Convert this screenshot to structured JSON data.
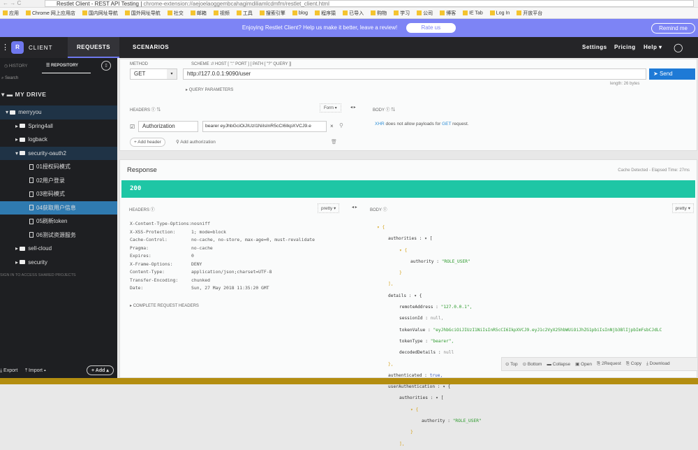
{
  "browser": {
    "tab_title": "Restlet Client - REST API Testing",
    "url": "chrome-extension://aejoelaoggembcahagimdiliamlcdmfm/restlet_client.html",
    "bookmarks": [
      "应用",
      "Chrome 网上应用店",
      "国内网址导航",
      "国外网址导航",
      "社交",
      "邮箱",
      "视频",
      "工具",
      "搜索引擎",
      "blog",
      "程序猿",
      "已导入",
      "购物",
      "学习",
      "公司",
      "博客",
      "IE Tab",
      "Log In",
      "开放平台"
    ]
  },
  "banner": {
    "text": "Enjoying Restlet Client? Help us make it better, leave a review!",
    "rate": "Rate us",
    "remind": "Remind me"
  },
  "nav": {
    "logo": "R",
    "client": "CLIENT",
    "tabs": [
      "REQUESTS",
      "SCENARIOS"
    ],
    "settings": "Settings",
    "pricing": "Pricing",
    "help": "Help ▾"
  },
  "sidebar": {
    "history": "HISTORY",
    "repository": "REPOSITORY",
    "search": "Search",
    "drive": "MY DRIVE",
    "project": "merryyou",
    "folders_top": [
      "Spring4all",
      "logback",
      "security-oauth2"
    ],
    "requests": [
      "01授权码模式",
      "02用户登录",
      "03密码模式",
      "04获取用户信息",
      "05刷新token",
      "06测试资源服务"
    ],
    "folders_bottom": [
      "sell-cloud",
      "security"
    ],
    "signin": "SIGN IN TO ACCESS SHARED PROJECTS",
    "export": "Export",
    "import": "Import ▴",
    "add": "Add ▴"
  },
  "request": {
    "method_label": "METHOD",
    "method": "GET",
    "scheme_label": "SCHEME :// HOST [ \":\" PORT ] [ PATH [ \"?\" QUERY ]]",
    "url": "http://127.0.0.1:9090/user",
    "send": "Send",
    "length": "length: 26 bytes",
    "query_params": "QUERY PARAMETERS",
    "headers_label": "HEADERS",
    "form": "Form ▾",
    "header_name": "Authorization",
    "header_value": "bearer eyJhbGciOiJIUzI1NiIsInR5cCI6IkpXVCJ9.e",
    "add_header": "+ Add header",
    "add_auth": "Add authorization",
    "body_label": "BODY",
    "body_xhr": "XHR",
    "body_msg": " does not allow payloads for ",
    "body_get": "GET",
    "body_end": " request."
  },
  "response": {
    "title": "Response",
    "cache": "Cache Detected - Elapsed Time: 27ms",
    "status": "200",
    "headers_label": "HEADERS",
    "pretty": "pretty ▾",
    "body_label": "BODY",
    "complete": "COMPLETE REQUEST HEADERS",
    "headers": [
      [
        "X-Content-Type-Options:",
        "nosniff"
      ],
      [
        "X-XSS-Protection:",
        "1; mode=block"
      ],
      [
        "Cache-Control:",
        "no-cache, no-store, max-age=0, must-revalidate"
      ],
      [
        "Pragma:",
        "no-cache"
      ],
      [
        "Expires:",
        "0"
      ],
      [
        "X-Frame-Options:",
        "DENY"
      ],
      [
        "Content-Type:",
        "application/json;charset=UTF-8"
      ],
      [
        "Transfer-Encoding:",
        "chunked"
      ],
      [
        "Date:",
        "Sun, 27 May 2018 11:35:20 GMT"
      ]
    ],
    "body_lines": [
      [
        "0",
        "▾ {",
        ""
      ],
      [
        "1",
        "authorities : ▾ [",
        ""
      ],
      [
        "2",
        "▾ {",
        ""
      ],
      [
        "3",
        "authority : ",
        "\"ROLE_USER\""
      ],
      [
        "2",
        "}",
        ""
      ],
      [
        "1",
        "],",
        ""
      ],
      [
        "1",
        "details : ▾ {",
        ""
      ],
      [
        "2",
        "remoteAddress : ",
        "\"127.0.0.1\","
      ],
      [
        "2",
        "sessionId : ",
        "null,"
      ],
      [
        "2",
        "tokenValue : ",
        "\"eyJhbGciOiJIUzI1NiIsInR5cCI6IkpXVCJ9.eyJ1c2VyX25hbWUiOiJhZG1pbiIsInNjb3BlIjpbImFsbCJdLC"
      ],
      [
        "2",
        "tokenType : ",
        "\"bearer\","
      ],
      [
        "2",
        "decodedDetails : ",
        "null"
      ],
      [
        "1",
        "},",
        ""
      ],
      [
        "1",
        "authenticated : ",
        "true,"
      ],
      [
        "1",
        "userAuthentication : ▾ {",
        ""
      ],
      [
        "2",
        "authorities : ▾ [",
        ""
      ],
      [
        "3",
        "▾ {",
        ""
      ],
      [
        "4",
        "authority : ",
        "\"ROLE_USER\""
      ],
      [
        "3",
        "}",
        ""
      ],
      [
        "2",
        "],",
        ""
      ]
    ],
    "toolbar": [
      "⊙ Top",
      "⊙ Bottom",
      "▬ Collapse",
      "▣ Open",
      "⎘ 2Request",
      "⎘ Copy",
      "⤓ Download"
    ]
  },
  "colors": {
    "accent": "#2f7ab0",
    "status_ok": "#1ec6a5",
    "banner": "#7d84f5",
    "send": "#1e7ad6"
  }
}
